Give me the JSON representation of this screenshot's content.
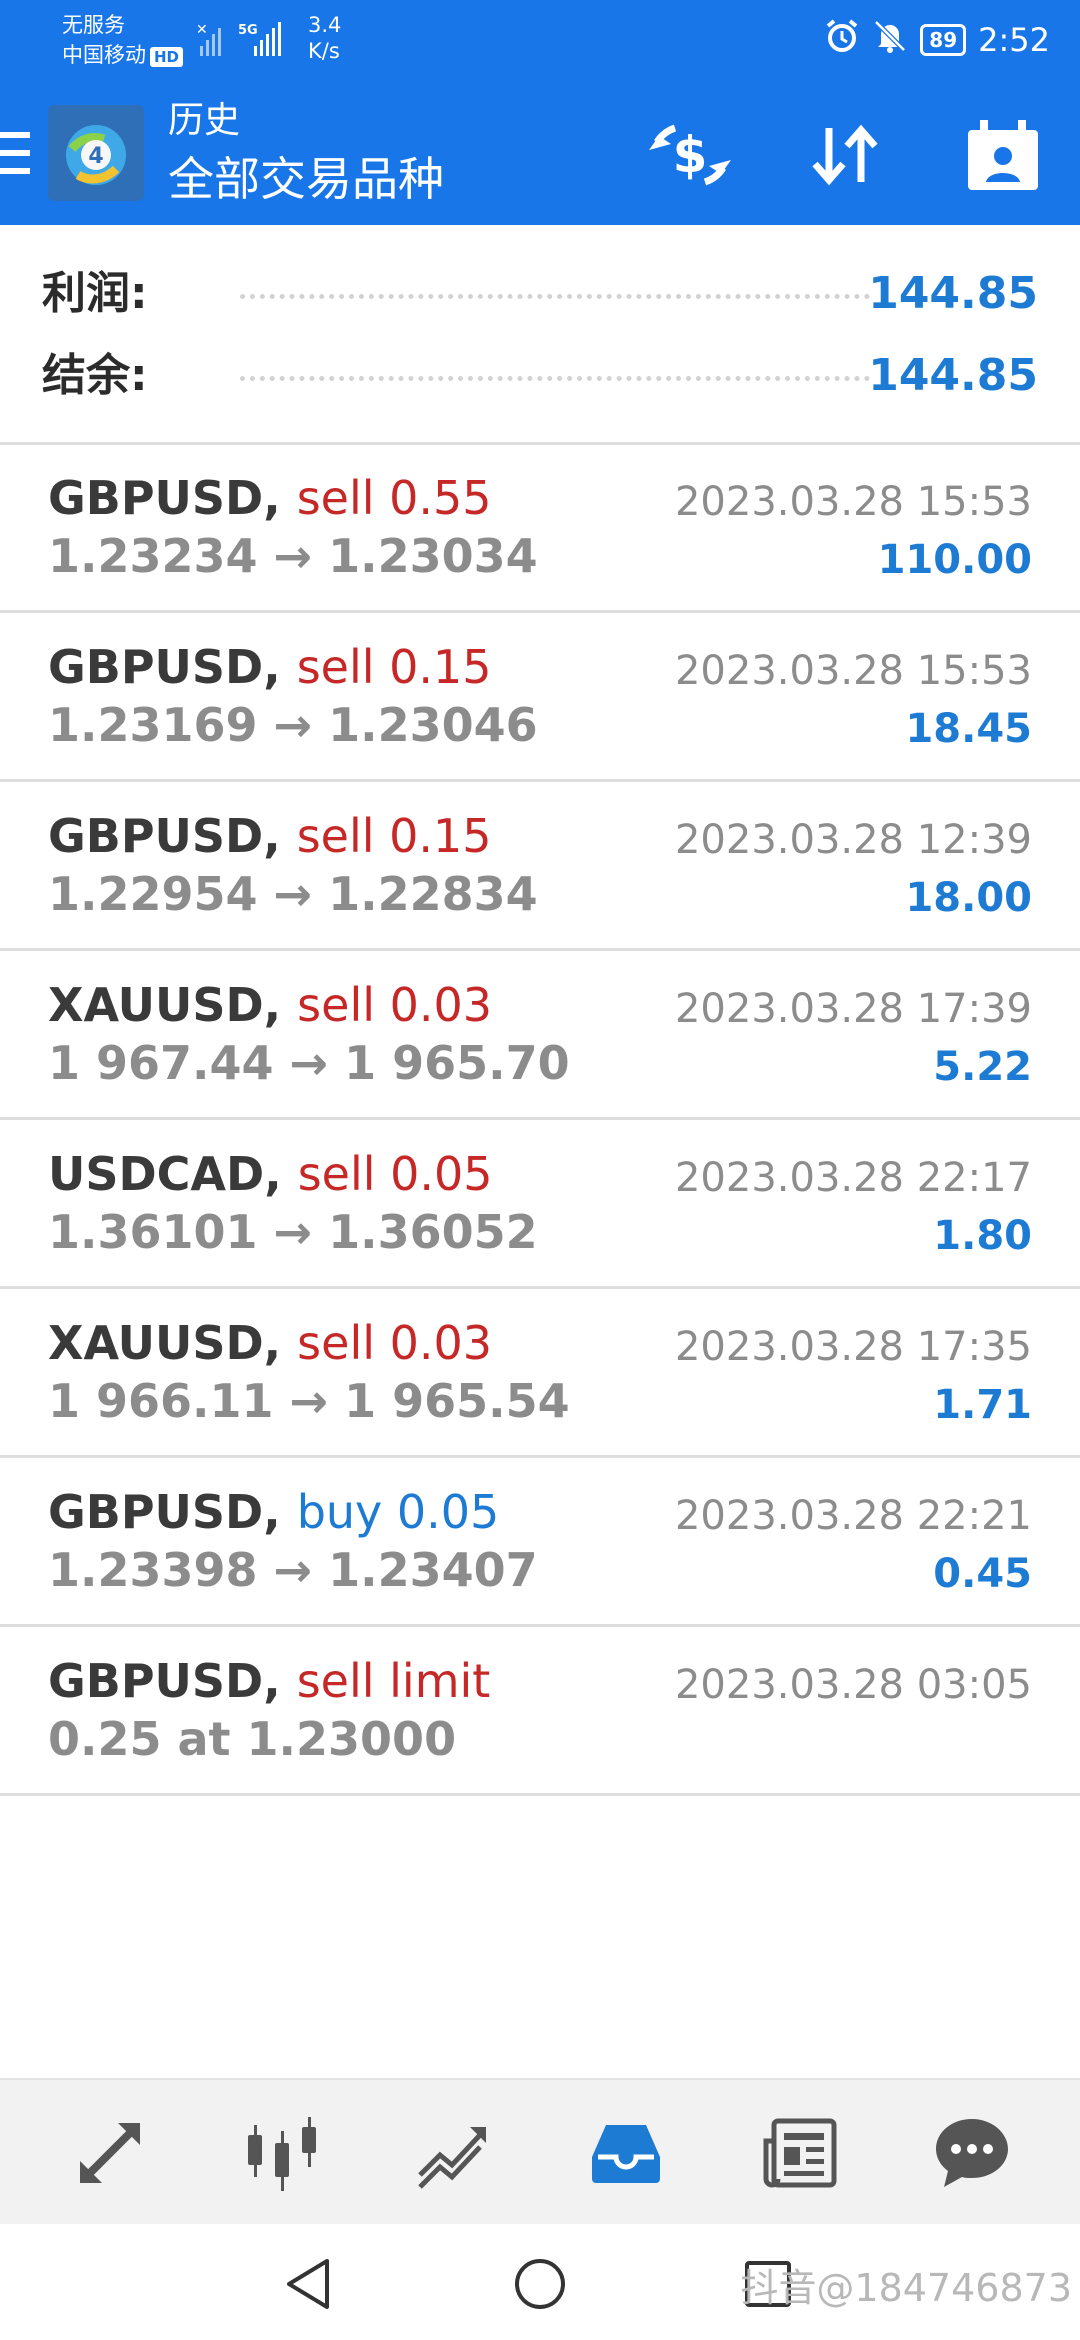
{
  "status_bar": {
    "carrier_line1": "无服务",
    "carrier_line2": "中国移动",
    "hd_badge": "HD",
    "network_label": "5G",
    "speed_value": "3.4",
    "speed_unit": "K/s",
    "battery_level": "89",
    "time": "2:52"
  },
  "toolbar": {
    "title": "历史",
    "subtitle": "全部交易品种",
    "icons": [
      "menu-icon",
      "mt-app-logo",
      "currency-exchange-icon",
      "sort-icon",
      "calendar-period-icon"
    ]
  },
  "summary": {
    "profit_label": "利润:",
    "profit_value": "144.85",
    "balance_label": "结余:",
    "balance_value": "144.85"
  },
  "deals": [
    {
      "symbol": "GBPUSD,",
      "type": "sell 0.55",
      "side": "sell",
      "prices": "1.23234 → 1.23034",
      "time": "2023.03.28 15:53",
      "profit": "110.00"
    },
    {
      "symbol": "GBPUSD,",
      "type": "sell 0.15",
      "side": "sell",
      "prices": "1.23169 → 1.23046",
      "time": "2023.03.28 15:53",
      "profit": "18.45"
    },
    {
      "symbol": "GBPUSD,",
      "type": "sell 0.15",
      "side": "sell",
      "prices": "1.22954 → 1.22834",
      "time": "2023.03.28 12:39",
      "profit": "18.00"
    },
    {
      "symbol": "XAUUSD,",
      "type": "sell 0.03",
      "side": "sell",
      "prices": "1 967.44 → 1 965.70",
      "time": "2023.03.28 17:39",
      "profit": "5.22"
    },
    {
      "symbol": "USDCAD,",
      "type": "sell 0.05",
      "side": "sell",
      "prices": "1.36101 → 1.36052",
      "time": "2023.03.28 22:17",
      "profit": "1.80"
    },
    {
      "symbol": "XAUUSD,",
      "type": "sell 0.03",
      "side": "sell",
      "prices": "1 966.11 → 1 965.54",
      "time": "2023.03.28 17:35",
      "profit": "1.71"
    },
    {
      "symbol": "GBPUSD,",
      "type": "buy 0.05",
      "side": "buy",
      "prices": "1.23398 → 1.23407",
      "time": "2023.03.28 22:21",
      "profit": "0.45"
    },
    {
      "symbol": "GBPUSD,",
      "type": "sell limit",
      "side": "sell",
      "prices": "0.25 at 1.23000",
      "time": "2023.03.28 03:05",
      "profit": ""
    }
  ],
  "bottom_nav": {
    "items": [
      "quotes-icon",
      "chart-icon",
      "trade-icon",
      "history-icon",
      "news-icon",
      "messages-icon"
    ],
    "active": "history-icon"
  },
  "watermark": "抖音@184746873",
  "colors": {
    "primary": "#1976e8",
    "sell": "#c62828",
    "buy": "#1e7bd4",
    "price_grey": "#8c8c8c",
    "nav_icon": "#555555"
  }
}
